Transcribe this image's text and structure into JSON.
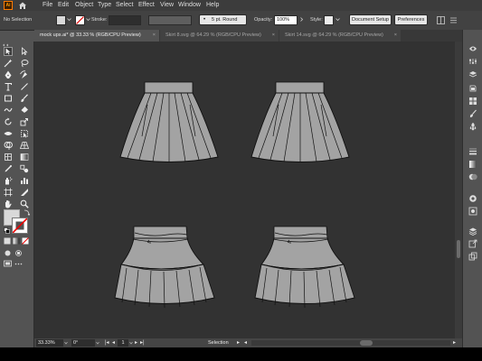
{
  "app": {
    "logo_text": "Ai"
  },
  "menu": {
    "items": [
      "File",
      "Edit",
      "Object",
      "Type",
      "Select",
      "Effect",
      "View",
      "Window",
      "Help"
    ]
  },
  "control_bar": {
    "selection_label": "No Selection",
    "stroke_label": "Stroke:",
    "brush_label": "5 pt. Round",
    "opacity_label": "Opacity:",
    "opacity_value": "100%",
    "style_label": "Style:",
    "document_setup": "Document Setup",
    "preferences": "Preferences"
  },
  "tabs": [
    {
      "label": "mock ups.ai* @ 33.33 % (RGB/CPU Preview)",
      "active": true
    },
    {
      "label": "Skirt 8.svg @ 64.29 % (RGB/CPU Preview)",
      "active": false
    },
    {
      "label": "Skirt 14.svg @ 64.29 % (RGB/CPU Preview)",
      "active": false
    }
  ],
  "tools": [
    "selection-tool-icon",
    "direct-selection-tool-icon",
    "magic-wand-tool-icon",
    "lasso-tool-icon",
    "pen-tool-icon",
    "curvature-tool-icon",
    "type-tool-icon",
    "line-tool-icon",
    "rectangle-tool-icon",
    "paintbrush-tool-icon",
    "shaper-tool-icon",
    "eraser-tool-icon",
    "rotate-tool-icon",
    "scale-tool-icon",
    "width-tool-icon",
    "free-transform-tool-icon",
    "shape-builder-tool-icon",
    "perspective-grid-tool-icon",
    "mesh-tool-icon",
    "gradient-tool-icon",
    "eyedropper-tool-icon",
    "blend-tool-icon",
    "symbol-sprayer-tool-icon",
    "column-graph-tool-icon",
    "artboard-tool-icon",
    "slice-tool-icon",
    "hand-tool-icon",
    "zoom-tool-icon"
  ],
  "right_panel": [
    "libraries-icon",
    "properties-icon",
    "layers-icon",
    "color-icon",
    "swatches-icon",
    "brushes-icon",
    "symbols-icon",
    "stroke-icon",
    "gradient-icon",
    "transparency-icon",
    "appearance-icon",
    "graphic-styles-icon",
    "layers-stack-icon",
    "asset-export-icon",
    "artboards-icon"
  ],
  "status": {
    "zoom": "33.33%",
    "rotation": "0°",
    "artboard_number": "1",
    "tool_name": "Selection"
  },
  "colors": {
    "skirt_fill": "#a3a3a3",
    "canvas": "#323232",
    "ui_panel": "#535353",
    "accent_orange": "#ff7c00"
  }
}
